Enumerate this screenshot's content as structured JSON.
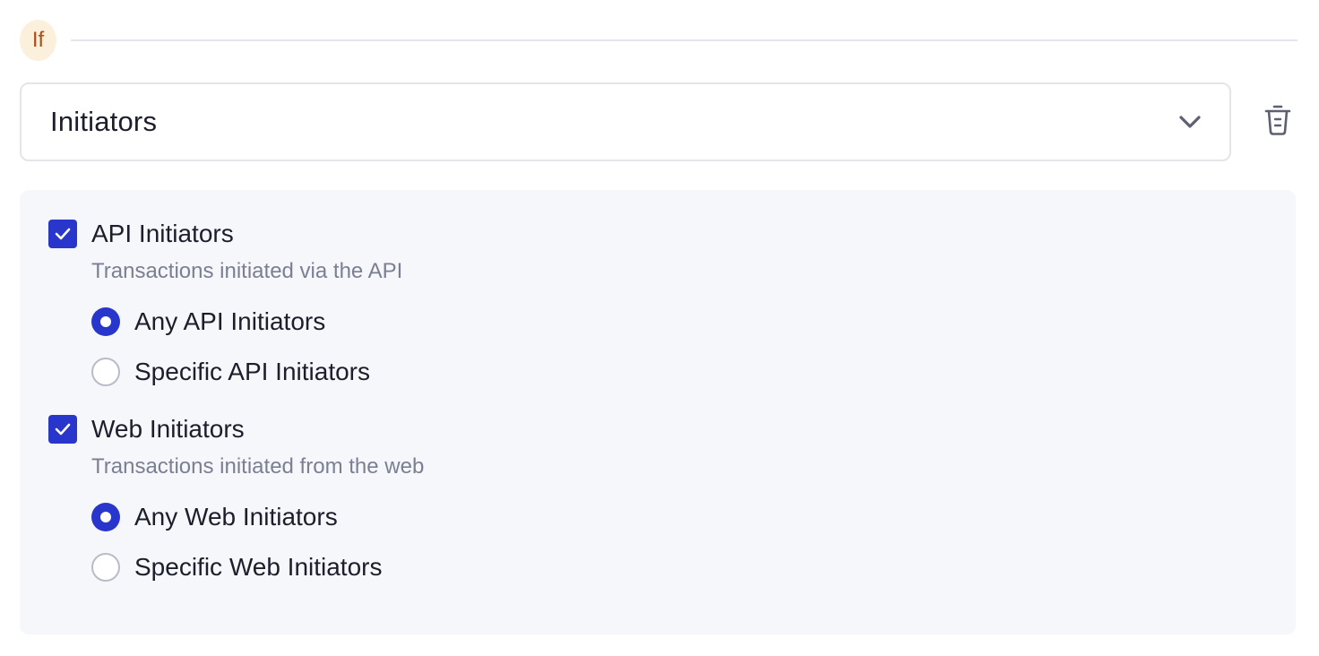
{
  "condition": {
    "badge": "If",
    "colors": {
      "badge_bg": "#fbf0dc",
      "badge_text": "#b24c16"
    }
  },
  "select": {
    "value": "Initiators",
    "icon": "chevron-down-icon"
  },
  "delete": {
    "icon": "trash-icon"
  },
  "colors": {
    "accent": "#2836cc",
    "panel_bg": "#f6f7fb",
    "muted_text": "#7b7f92"
  },
  "groups": [
    {
      "label": "API Initiators",
      "checked": true,
      "description": "Transactions initiated via the API",
      "options": [
        {
          "label": "Any API Initiators",
          "selected": true
        },
        {
          "label": "Specific API Initiators",
          "selected": false
        }
      ]
    },
    {
      "label": "Web Initiators",
      "checked": true,
      "description": "Transactions initiated from the web",
      "options": [
        {
          "label": "Any Web Initiators",
          "selected": true
        },
        {
          "label": "Specific Web Initiators",
          "selected": false
        }
      ]
    }
  ]
}
